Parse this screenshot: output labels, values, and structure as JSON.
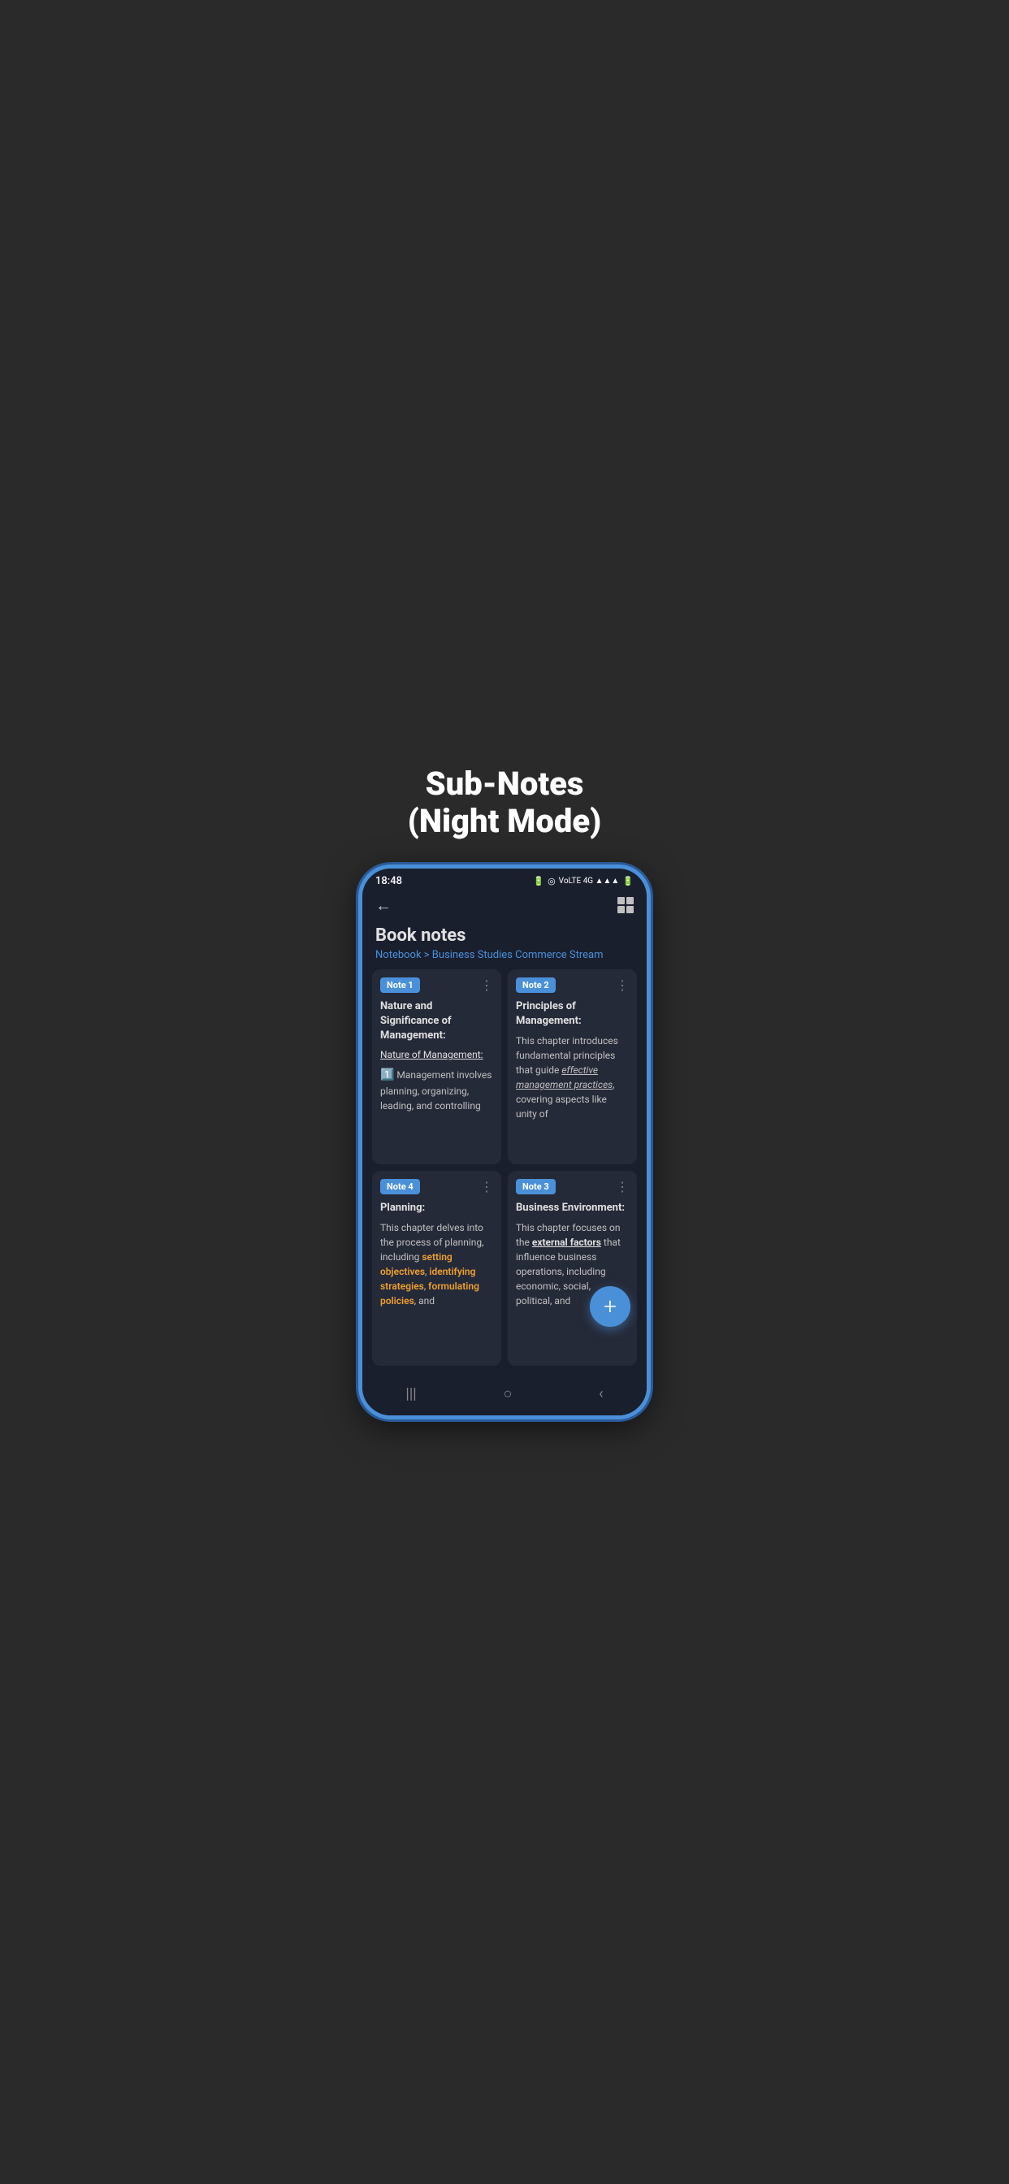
{
  "page": {
    "title": "Sub-Notes\n(Night Mode)"
  },
  "statusBar": {
    "time": "18:48",
    "icons": "⊞ ☷ ⋮⋮  🔋 ◎ VoLTE 4G R ▲▲▲ 🔋"
  },
  "header": {
    "title": "Book notes",
    "breadcrumb": "Notebook >  Business Studies Commerce Stream"
  },
  "notes": [
    {
      "badge": "Note 1",
      "title": "Nature and Significance of Management:",
      "subtitle": "Nature of Management:",
      "body": "🔷 Management involves planning, organizing, leading, and controlling"
    },
    {
      "badge": "Note 2",
      "title": "Principles of Management:",
      "body": "This chapter introduces fundamental principles that guide effective management practices, covering aspects like unity of"
    },
    {
      "badge": "Note 4",
      "title": "Planning:",
      "body": "This chapter delves into the process of planning, including setting objectives, identifying strategies, formulating policies, and"
    },
    {
      "badge": "Note 3",
      "title": "Business Environment:",
      "body": "This chapter focuses on the external factors that influence business operations, including economic, social, political, and"
    }
  ],
  "fab": {
    "label": "+"
  },
  "navbar": {
    "back": "←",
    "home": "○",
    "recent": "|||"
  }
}
